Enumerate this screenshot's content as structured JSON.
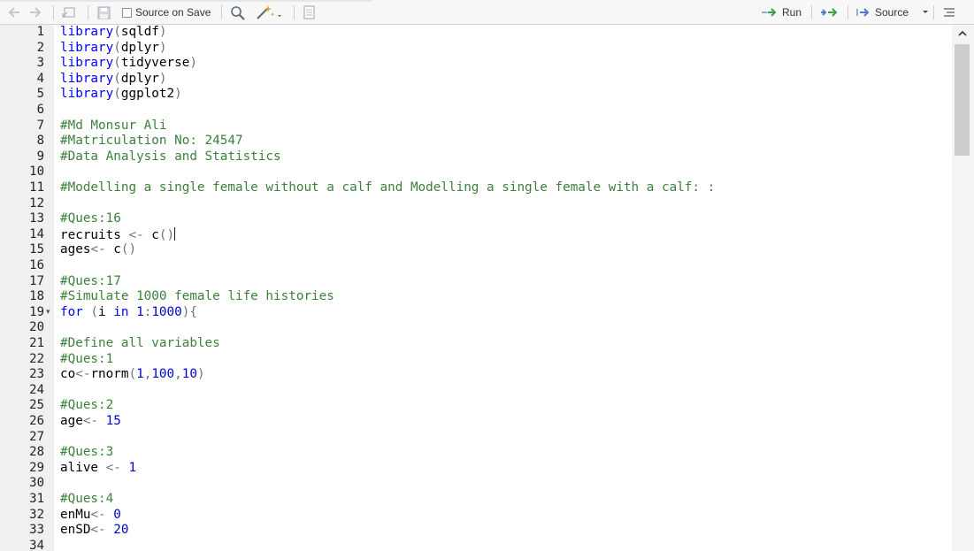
{
  "toolbar": {
    "source_on_save_label": "Source on Save",
    "run_label": "Run",
    "source_label": "Source",
    "colors": {
      "green_arrow": "#3aa142",
      "blue": "#4d7fc4"
    }
  },
  "colors": {
    "keyword": "#0000ff",
    "number": "#0000cd",
    "comment": "#3c803c",
    "operator": "#687687",
    "gutter": "#f0f0f0"
  },
  "lines": [
    {
      "n": "1",
      "tokens": [
        [
          "fn",
          "library"
        ],
        [
          "op",
          "("
        ],
        [
          "id",
          "sqldf"
        ],
        [
          "op",
          ")"
        ]
      ]
    },
    {
      "n": "2",
      "tokens": [
        [
          "fn",
          "library"
        ],
        [
          "op",
          "("
        ],
        [
          "id",
          "dplyr"
        ],
        [
          "op",
          ")"
        ]
      ]
    },
    {
      "n": "3",
      "tokens": [
        [
          "fn",
          "library"
        ],
        [
          "op",
          "("
        ],
        [
          "id",
          "tidyverse"
        ],
        [
          "op",
          ")"
        ]
      ]
    },
    {
      "n": "4",
      "tokens": [
        [
          "fn",
          "library"
        ],
        [
          "op",
          "("
        ],
        [
          "id",
          "dplyr"
        ],
        [
          "op",
          ")"
        ]
      ]
    },
    {
      "n": "5",
      "tokens": [
        [
          "fn",
          "library"
        ],
        [
          "op",
          "("
        ],
        [
          "id",
          "ggplot2"
        ],
        [
          "op",
          ")"
        ]
      ]
    },
    {
      "n": "6",
      "tokens": []
    },
    {
      "n": "7",
      "tokens": [
        [
          "cm",
          "#Md Monsur Ali"
        ]
      ]
    },
    {
      "n": "8",
      "tokens": [
        [
          "cm",
          "#Matriculation No: 24547"
        ]
      ]
    },
    {
      "n": "9",
      "tokens": [
        [
          "cm",
          "#Data Analysis and Statistics"
        ]
      ]
    },
    {
      "n": "10",
      "tokens": []
    },
    {
      "n": "11",
      "tokens": [
        [
          "cm",
          "#Modelling a single female without a calf and Modelling a single female with a calf: :"
        ]
      ]
    },
    {
      "n": "12",
      "tokens": []
    },
    {
      "n": "13",
      "tokens": [
        [
          "cm",
          "#Ques:16"
        ]
      ]
    },
    {
      "n": "14",
      "tokens": [
        [
          "id",
          "recruits "
        ],
        [
          "op",
          "<-"
        ],
        [
          "id",
          " c"
        ],
        [
          "op",
          "()"
        ],
        [
          "cursor",
          ""
        ]
      ]
    },
    {
      "n": "15",
      "tokens": [
        [
          "id",
          "ages"
        ],
        [
          "op",
          "<-"
        ],
        [
          "id",
          " c"
        ],
        [
          "op",
          "()"
        ]
      ]
    },
    {
      "n": "16",
      "tokens": []
    },
    {
      "n": "17",
      "tokens": [
        [
          "cm",
          "#Ques:17"
        ]
      ]
    },
    {
      "n": "18",
      "tokens": [
        [
          "cm",
          "#Simulate 1000 female life histories"
        ]
      ]
    },
    {
      "n": "19",
      "fold": true,
      "tokens": [
        [
          "kw",
          "for"
        ],
        [
          "op",
          " ("
        ],
        [
          "id",
          "i "
        ],
        [
          "kw",
          "in"
        ],
        [
          "num",
          " 1"
        ],
        [
          "op",
          ":"
        ],
        [
          "num",
          "1000"
        ],
        [
          "op",
          "){"
        ]
      ]
    },
    {
      "n": "20",
      "tokens": []
    },
    {
      "n": "21",
      "tokens": [
        [
          "cm",
          "#Define all variables"
        ]
      ]
    },
    {
      "n": "22",
      "tokens": [
        [
          "cm",
          "#Ques:1"
        ]
      ]
    },
    {
      "n": "23",
      "tokens": [
        [
          "id",
          "co"
        ],
        [
          "op",
          "<-"
        ],
        [
          "id",
          "rnorm"
        ],
        [
          "op",
          "("
        ],
        [
          "num",
          "1"
        ],
        [
          "op",
          ","
        ],
        [
          "num",
          "100"
        ],
        [
          "op",
          ","
        ],
        [
          "num",
          "10"
        ],
        [
          "op",
          ")"
        ]
      ]
    },
    {
      "n": "24",
      "tokens": []
    },
    {
      "n": "25",
      "tokens": [
        [
          "cm",
          "#Ques:2"
        ]
      ]
    },
    {
      "n": "26",
      "tokens": [
        [
          "id",
          "age"
        ],
        [
          "op",
          "<-"
        ],
        [
          "num",
          " 15"
        ]
      ]
    },
    {
      "n": "27",
      "tokens": []
    },
    {
      "n": "28",
      "tokens": [
        [
          "cm",
          "#Ques:3"
        ]
      ]
    },
    {
      "n": "29",
      "tokens": [
        [
          "id",
          "alive "
        ],
        [
          "op",
          "<-"
        ],
        [
          "num",
          " 1"
        ]
      ]
    },
    {
      "n": "30",
      "tokens": []
    },
    {
      "n": "31",
      "tokens": [
        [
          "cm",
          "#Ques:4"
        ]
      ]
    },
    {
      "n": "32",
      "tokens": [
        [
          "id",
          "enMu"
        ],
        [
          "op",
          "<-"
        ],
        [
          "num",
          " 0"
        ]
      ]
    },
    {
      "n": "33",
      "tokens": [
        [
          "id",
          "enSD"
        ],
        [
          "op",
          "<-"
        ],
        [
          "num",
          " 20"
        ]
      ]
    },
    {
      "n": "34",
      "tokens": []
    }
  ]
}
